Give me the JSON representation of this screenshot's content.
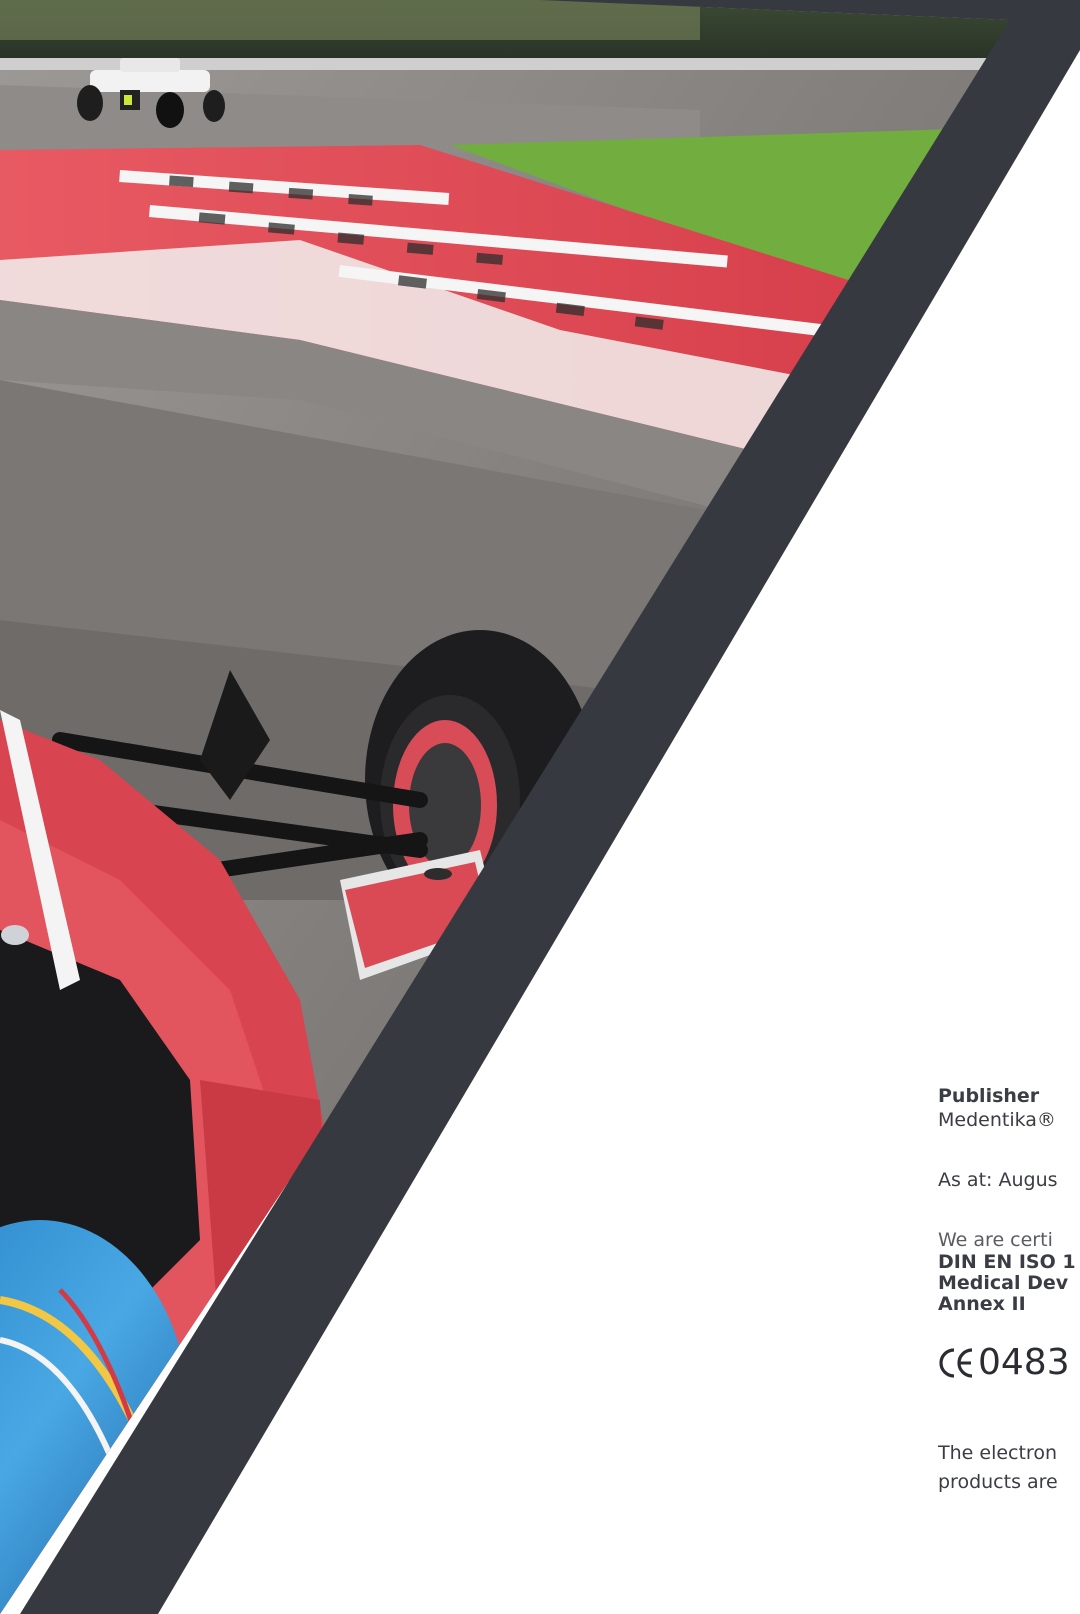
{
  "imprint": {
    "publisher_heading": "Publisher",
    "publisher_name": "Medentika®",
    "as_at": "As at: Augus",
    "certified_intro": "We are certi",
    "cert_lines": [
      "DIN EN ISO 1",
      "Medical Dev",
      "Annex II"
    ],
    "ce_number": "0483",
    "footer_lines": [
      "The electron",
      "products are",
      ""
    ]
  },
  "colors": {
    "dark_band": "#363a40",
    "text": "#3b3d44",
    "track_red": "#d94a55",
    "grass": "#6aa53a",
    "asphalt": "#8a8684"
  },
  "icons": {
    "ce_mark": "ce-conformity-mark"
  }
}
